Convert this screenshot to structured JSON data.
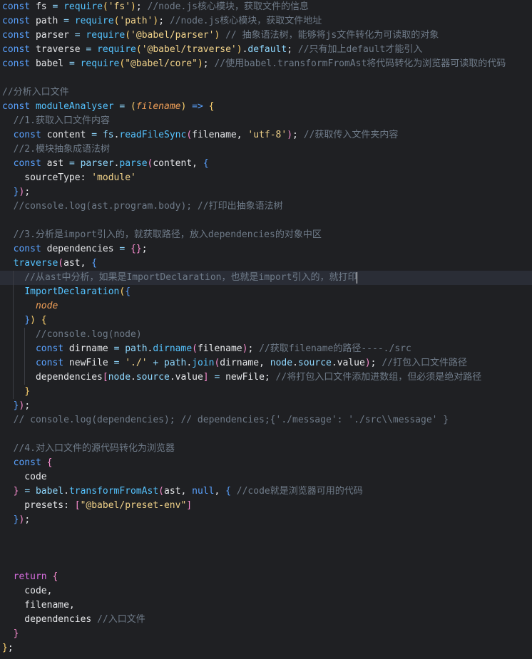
{
  "editor": {
    "lines": [
      {
        "segments": [
          [
            "k",
            "const"
          ],
          [
            "v",
            " fs "
          ],
          [
            "n",
            "="
          ],
          [
            "v",
            " "
          ],
          [
            "f",
            "require"
          ],
          [
            "y",
            "("
          ],
          [
            "s",
            "'fs'"
          ],
          [
            "y",
            ")"
          ],
          [
            "v",
            ";"
          ],
          [
            "c",
            " //node.js核心模块，获取文件的信息"
          ]
        ]
      },
      {
        "segments": [
          [
            "k",
            "const"
          ],
          [
            "v",
            " path "
          ],
          [
            "n",
            "="
          ],
          [
            "v",
            " "
          ],
          [
            "f",
            "require"
          ],
          [
            "y",
            "("
          ],
          [
            "s",
            "'path'"
          ],
          [
            "y",
            ")"
          ],
          [
            "v",
            ";"
          ],
          [
            "c",
            " //node.js核心模块，获取文件地址"
          ]
        ]
      },
      {
        "segments": [
          [
            "k",
            "const"
          ],
          [
            "v",
            " parser "
          ],
          [
            "n",
            "="
          ],
          [
            "v",
            " "
          ],
          [
            "f",
            "require"
          ],
          [
            "y",
            "("
          ],
          [
            "s",
            "'@babel/parser'"
          ],
          [
            "y",
            ")"
          ],
          [
            "c",
            " // 抽象语法树，能够将js文件转化为可读取的对象"
          ]
        ]
      },
      {
        "segments": [
          [
            "k",
            "const"
          ],
          [
            "v",
            " traverse "
          ],
          [
            "n",
            "="
          ],
          [
            "v",
            " "
          ],
          [
            "f",
            "require"
          ],
          [
            "y",
            "("
          ],
          [
            "s",
            "'@babel/traverse'"
          ],
          [
            "y",
            ")"
          ],
          [
            "v",
            "."
          ],
          [
            "n",
            "default"
          ],
          [
            "v",
            ";"
          ],
          [
            "c",
            " //只有加上default才能引入"
          ]
        ]
      },
      {
        "segments": [
          [
            "k",
            "const"
          ],
          [
            "v",
            " babel "
          ],
          [
            "n",
            "="
          ],
          [
            "v",
            " "
          ],
          [
            "f",
            "require"
          ],
          [
            "y",
            "("
          ],
          [
            "s",
            "\"@babel/core\""
          ],
          [
            "y",
            ")"
          ],
          [
            "v",
            ";"
          ],
          [
            "c",
            " //使用babel.transformFromAst将代码转化为浏览器可读取的代码"
          ]
        ]
      },
      {
        "segments": []
      },
      {
        "segments": [
          [
            "c",
            "//分析入口文件"
          ]
        ]
      },
      {
        "segments": [
          [
            "k",
            "const"
          ],
          [
            "v",
            " "
          ],
          [
            "f",
            "moduleAnalyser"
          ],
          [
            "v",
            " "
          ],
          [
            "n",
            "="
          ],
          [
            "v",
            " "
          ],
          [
            "y",
            "("
          ],
          [
            "i",
            "filename"
          ],
          [
            "y",
            ")"
          ],
          [
            "v",
            " "
          ],
          [
            "k",
            "=>"
          ],
          [
            "v",
            " "
          ],
          [
            "y",
            "{"
          ]
        ]
      },
      {
        "segments": [
          [
            "c",
            "  //1.获取入口文件内容"
          ]
        ]
      },
      {
        "segments": [
          [
            "v",
            "  "
          ],
          [
            "k",
            "const"
          ],
          [
            "v",
            " content "
          ],
          [
            "n",
            "="
          ],
          [
            "v",
            " "
          ],
          [
            "n",
            "fs"
          ],
          [
            "v",
            "."
          ],
          [
            "f",
            "readFileSync"
          ],
          [
            "p",
            "("
          ],
          [
            "v",
            "filename, "
          ],
          [
            "s",
            "'utf-8'"
          ],
          [
            "p",
            ")"
          ],
          [
            "v",
            ";"
          ],
          [
            "c",
            " //获取传入文件夹内容"
          ]
        ]
      },
      {
        "segments": [
          [
            "c",
            "  //2.模块抽象成语法树"
          ]
        ]
      },
      {
        "segments": [
          [
            "v",
            "  "
          ],
          [
            "k",
            "const"
          ],
          [
            "v",
            " ast "
          ],
          [
            "n",
            "="
          ],
          [
            "v",
            " "
          ],
          [
            "n",
            "parser"
          ],
          [
            "v",
            "."
          ],
          [
            "f",
            "parse"
          ],
          [
            "p",
            "("
          ],
          [
            "v",
            "content, "
          ],
          [
            "k",
            "{"
          ]
        ]
      },
      {
        "segments": [
          [
            "v",
            "    sourceType: "
          ],
          [
            "s",
            "'module'"
          ]
        ]
      },
      {
        "segments": [
          [
            "v",
            "  "
          ],
          [
            "k",
            "}"
          ],
          [
            "p",
            ")"
          ],
          [
            "v",
            ";"
          ]
        ]
      },
      {
        "segments": [
          [
            "c",
            "  //console.log(ast.program.body); //打印出抽象语法树"
          ]
        ]
      },
      {
        "segments": []
      },
      {
        "segments": [
          [
            "c",
            "  //3.分析是import引入的，就获取路径，放入dependencies的对象中区"
          ]
        ]
      },
      {
        "segments": [
          [
            "v",
            "  "
          ],
          [
            "k",
            "const"
          ],
          [
            "v",
            " dependencies "
          ],
          [
            "n",
            "="
          ],
          [
            "v",
            " "
          ],
          [
            "p",
            "{}"
          ],
          [
            "v",
            ";"
          ]
        ]
      },
      {
        "segments": [
          [
            "v",
            "  "
          ],
          [
            "f",
            "traverse"
          ],
          [
            "p",
            "("
          ],
          [
            "v",
            "ast, "
          ],
          [
            "k",
            "{"
          ]
        ]
      },
      {
        "segments": [
          [
            "c",
            "    //从ast中分析，如果是ImportDeclaration，也就是import引入的，就打印"
          ]
        ],
        "highlight": true,
        "cursor": true
      },
      {
        "segments": [
          [
            "v",
            "    "
          ],
          [
            "f",
            "ImportDeclaration"
          ],
          [
            "y",
            "("
          ],
          [
            "k",
            "{"
          ]
        ]
      },
      {
        "segments": [
          [
            "v",
            "      "
          ],
          [
            "i",
            "node"
          ]
        ]
      },
      {
        "segments": [
          [
            "v",
            "    "
          ],
          [
            "k",
            "}"
          ],
          [
            "y",
            ")"
          ],
          [
            "v",
            " "
          ],
          [
            "y",
            "{"
          ]
        ]
      },
      {
        "segments": [
          [
            "c",
            "      //console.log(node)"
          ]
        ]
      },
      {
        "segments": [
          [
            "v",
            "      "
          ],
          [
            "k",
            "const"
          ],
          [
            "v",
            " dirname "
          ],
          [
            "n",
            "="
          ],
          [
            "v",
            " "
          ],
          [
            "n",
            "path"
          ],
          [
            "v",
            "."
          ],
          [
            "f",
            "dirname"
          ],
          [
            "p",
            "("
          ],
          [
            "v",
            "filename"
          ],
          [
            "p",
            ")"
          ],
          [
            "v",
            ";"
          ],
          [
            "c",
            " //获取filename的路径----./src"
          ]
        ]
      },
      {
        "segments": [
          [
            "v",
            "      "
          ],
          [
            "k",
            "const"
          ],
          [
            "v",
            " newFile "
          ],
          [
            "n",
            "="
          ],
          [
            "v",
            " "
          ],
          [
            "s",
            "'./'"
          ],
          [
            "v",
            " "
          ],
          [
            "n",
            "+"
          ],
          [
            "v",
            " "
          ],
          [
            "n",
            "path"
          ],
          [
            "v",
            "."
          ],
          [
            "f",
            "join"
          ],
          [
            "p",
            "("
          ],
          [
            "v",
            "dirname, "
          ],
          [
            "n",
            "node"
          ],
          [
            "v",
            "."
          ],
          [
            "n",
            "source"
          ],
          [
            "v",
            ".value"
          ],
          [
            "p",
            ")"
          ],
          [
            "v",
            ";"
          ],
          [
            "c",
            " //打包入口文件路径"
          ]
        ]
      },
      {
        "segments": [
          [
            "v",
            "      dependencies"
          ],
          [
            "p",
            "["
          ],
          [
            "n",
            "node"
          ],
          [
            "v",
            "."
          ],
          [
            "n",
            "source"
          ],
          [
            "v",
            ".value"
          ],
          [
            "p",
            "]"
          ],
          [
            "v",
            " "
          ],
          [
            "n",
            "="
          ],
          [
            "v",
            " newFile;"
          ],
          [
            "c",
            " //将打包入口文件添加进数组，但必须是绝对路径"
          ]
        ]
      },
      {
        "segments": [
          [
            "v",
            "    "
          ],
          [
            "y",
            "}"
          ]
        ]
      },
      {
        "segments": [
          [
            "v",
            "  "
          ],
          [
            "k",
            "}"
          ],
          [
            "p",
            ")"
          ],
          [
            "v",
            ";"
          ]
        ]
      },
      {
        "segments": [
          [
            "c",
            "  // console.log(dependencies); // dependencies;{'./message': './src\\\\message' }"
          ]
        ]
      },
      {
        "segments": []
      },
      {
        "segments": [
          [
            "c",
            "  //4.对入口文件的源代码转化为浏览器"
          ]
        ]
      },
      {
        "segments": [
          [
            "v",
            "  "
          ],
          [
            "k",
            "const"
          ],
          [
            "v",
            " "
          ],
          [
            "p",
            "{"
          ]
        ]
      },
      {
        "segments": [
          [
            "v",
            "    code"
          ]
        ]
      },
      {
        "segments": [
          [
            "v",
            "  "
          ],
          [
            "p",
            "}"
          ],
          [
            "v",
            " "
          ],
          [
            "n",
            "="
          ],
          [
            "v",
            " "
          ],
          [
            "n",
            "babel"
          ],
          [
            "v",
            "."
          ],
          [
            "f",
            "transformFromAst"
          ],
          [
            "p",
            "("
          ],
          [
            "v",
            "ast, "
          ],
          [
            "k",
            "null"
          ],
          [
            "v",
            ", "
          ],
          [
            "k",
            "{"
          ],
          [
            "c",
            " //code就是浏览器可用的代码"
          ]
        ]
      },
      {
        "segments": [
          [
            "v",
            "    presets: "
          ],
          [
            "p",
            "["
          ],
          [
            "s",
            "\"@babel/preset-env\""
          ],
          [
            "p",
            "]"
          ]
        ]
      },
      {
        "segments": [
          [
            "v",
            "  "
          ],
          [
            "k",
            "}"
          ],
          [
            "p",
            ")"
          ],
          [
            "v",
            ";"
          ]
        ]
      },
      {
        "segments": []
      },
      {
        "segments": []
      },
      {
        "segments": []
      },
      {
        "segments": [
          [
            "v",
            "  "
          ],
          [
            "r",
            "return"
          ],
          [
            "v",
            " "
          ],
          [
            "p",
            "{"
          ]
        ]
      },
      {
        "segments": [
          [
            "v",
            "    code,"
          ]
        ]
      },
      {
        "segments": [
          [
            "v",
            "    filename,"
          ]
        ]
      },
      {
        "segments": [
          [
            "v",
            "    dependencies "
          ],
          [
            "c",
            "//入口文件"
          ]
        ]
      },
      {
        "segments": [
          [
            "v",
            "  "
          ],
          [
            "p",
            "}"
          ]
        ]
      },
      {
        "segments": [
          [
            "y",
            "}"
          ],
          [
            "v",
            ";"
          ]
        ]
      }
    ]
  }
}
